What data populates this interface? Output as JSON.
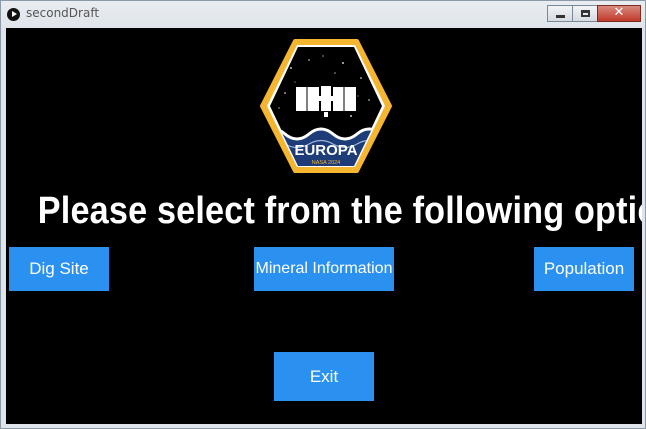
{
  "window": {
    "title": "secondDraft"
  },
  "logo": {
    "name": "EUROPA",
    "subtitle": "NASA 2024",
    "icon": "satellite-icon",
    "colors": {
      "border": "#f4b630",
      "inner_ring": "#1d3c78",
      "space": "#000000",
      "waves": "#1d3c78"
    }
  },
  "main": {
    "headline": "Please select from the following options"
  },
  "buttons": {
    "dig_site": "Dig Site",
    "mineral_information": "Mineral Information",
    "population": "Population",
    "exit": "Exit"
  },
  "colors": {
    "background": "#000000",
    "button": "#2a91f0",
    "text": "#ffffff"
  }
}
